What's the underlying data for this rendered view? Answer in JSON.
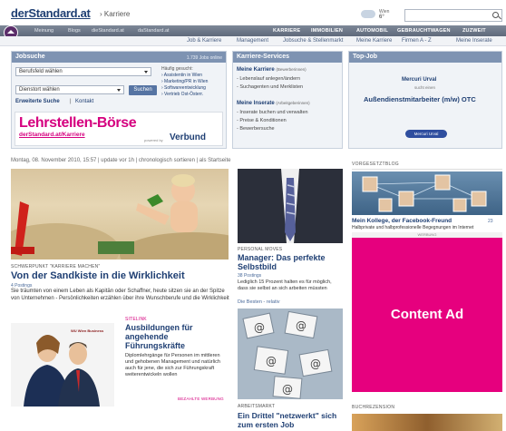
{
  "header": {
    "logo": "derStandard.at",
    "breadcrumb": "› Karriere",
    "weather": {
      "city": "Wien",
      "temp": "6°"
    }
  },
  "nav": {
    "left": [
      "Meinung",
      "Blogs",
      "dieStandard.at",
      "daStandard.at"
    ],
    "right": [
      "KARRIERE",
      "IMMOBILIEN",
      "AUTOMOBIL",
      "GEBRAUCHTWAGEN",
      "ZUZWEIT"
    ],
    "sub": [
      "Job & Karriere",
      "Management",
      "Jobsuche & Stellenmarkt",
      "Meine Karriere",
      "Firmen A - Z",
      "Meine Inserate"
    ]
  },
  "jobsuche": {
    "title": "Jobsuche",
    "count": "1.739 Jobs online",
    "field1": "Berufsfeld wählen",
    "field2": "Dienstort wählen",
    "button": "Suchen",
    "adv": "Erweiterte Suche",
    "contact": "Kontakt",
    "popular_title": "Häufig gesucht:",
    "popular": [
      "› Assistentin in Wien",
      "› Marketing/PR in Wien",
      "› Softwareentwicklung",
      "› Vertrieb Ost-Österr."
    ],
    "banner_title": "Lehrstellen-Börse",
    "banner_sub": "derStandard.at/Karriere",
    "banner_powered": "powered by",
    "banner_sponsor": "Verbund"
  },
  "karriere_services": {
    "title": "Karriere-Services",
    "sec1_title": "Meine Karriere",
    "sec1_note": "(Bewerberinnen)",
    "sec1_items": [
      "- Lebenslauf anlegen/ändern",
      "- Suchagenten und Merklisten"
    ],
    "sec2_title": "Meine Inserate",
    "sec2_note": "(Arbeitgeberinnen)",
    "sec2_items": [
      "- Inserate buchen und verwalten",
      "- Preise & Konditionen",
      "- Bewerbersuche"
    ]
  },
  "topjob": {
    "title": "Top-Job",
    "company": "Mercuri Urval",
    "sub": "sucht einen",
    "position": "Außendienstmitarbeiter (m/w) OTC",
    "pill": "Mercuri Urval"
  },
  "dateline": "Montag, 08. November 2010, 15:57 | update vor 1h | chronologisch sortieren | als Startseite",
  "main_story": {
    "kicker": "SCHWERPUNKT \"KARRIERE MACHEN\"",
    "title": "Von der Sandkiste in die Wirklichkeit",
    "meta": "4 Postings",
    "text": "Sie träumten von einem Leben als Kapitän oder Schaffner, heute sitzen sie an der Spitze von Unternehmen - Persönlichkeiten erzählen über ihre Wunschberufe und die Wirklichkeit"
  },
  "sitelink": {
    "kicker": "SITELINK",
    "title": "Ausbildungen für angehende Führungskräfte",
    "text": "Diplomlehrgänge für Personen im mittleren und gehobenen Management und natürlich auch für jene, die sich zur Führungskraft weiterentwickeln wollen",
    "tag": "BEZAHLTE WERBUNG",
    "img_label": "WU Wien Business"
  },
  "personal_moves": {
    "kicker": "PERSONAL MOVES",
    "title": "Manager: Das perfekte Selbstbild",
    "meta": "38 Postings",
    "text": "Lediglich 15 Prozent halten es für möglich, dass sie selbst an sich arbeiten müssten",
    "link": "Die Besten - relativ"
  },
  "arbeitsmarkt": {
    "kicker": "ARBEITSMARKT",
    "title": "Ein Drittel \"netzwerkt\" sich zum ersten Job"
  },
  "vorgesetzt": {
    "head": "VORGESETZTBLOG",
    "title": "Mein Kollege, der Facebook-Freund",
    "count": "23",
    "text": "Halbprivate und halbprofessionelle Begegnungen im Internet"
  },
  "ad": {
    "label": "WERBUNG",
    "text": "Content Ad"
  },
  "buch": {
    "head": "BUCHREZENSION"
  },
  "colors": {
    "brand": "#1f3f73",
    "box_head": "#7e93b2",
    "accent_pink": "#e6007e",
    "lehr_pink": "#d5007f"
  }
}
